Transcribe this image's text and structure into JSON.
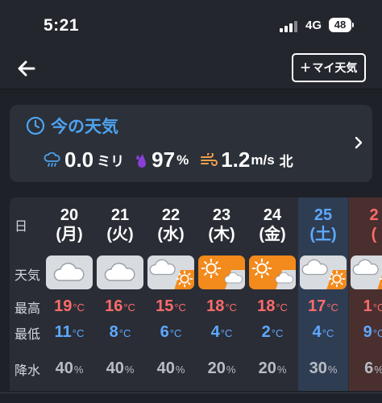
{
  "status": {
    "time": "5:21",
    "network": "4G",
    "battery": "48"
  },
  "nav": {
    "add_label": "マイ天気"
  },
  "now": {
    "title": "今の天気",
    "precip_value": "0.0",
    "precip_unit": "ミリ",
    "humidity_value": "97",
    "humidity_unit": "%",
    "wind_value": "1.2",
    "wind_unit": "m/s",
    "wind_dir": "北"
  },
  "forecast": {
    "labels": {
      "day": "日",
      "weather": "天気",
      "high": "最高",
      "low": "最低",
      "rain": "降水"
    },
    "temp_unit": "°C",
    "pct_unit": "%",
    "days": [
      {
        "date": "20",
        "dow": "(月)",
        "weather": "cloudy-icon",
        "high": "19",
        "low": "11",
        "rain": "40"
      },
      {
        "date": "21",
        "dow": "(火)",
        "weather": "cloudy-icon",
        "high": "16",
        "low": "8",
        "rain": "40"
      },
      {
        "date": "22",
        "dow": "(水)",
        "weather": "cloudy-then-sunny-icon",
        "high": "15",
        "low": "6",
        "rain": "40"
      },
      {
        "date": "23",
        "dow": "(木)",
        "weather": "sunny-then-cloudy-icon",
        "high": "18",
        "low": "4",
        "rain": "20"
      },
      {
        "date": "24",
        "dow": "(金)",
        "weather": "sunny-then-cloudy-icon",
        "high": "18",
        "low": "2",
        "rain": "20"
      },
      {
        "date": "25",
        "dow": "(土)",
        "weather": "cloudy-then-sunny-icon",
        "high": "17",
        "low": "4",
        "rain": "30"
      },
      {
        "date": "2",
        "dow": "(",
        "weather": "cloudy-then-sunny-icon",
        "high": "1",
        "low": "9",
        "rain": "6"
      }
    ]
  },
  "colors": {
    "accent_blue": "#4da3f0",
    "high": "#ff6b6b",
    "low": "#5ea8ff",
    "sun_orange": "#f28a1c",
    "saturday": "#5ea8ff",
    "sunday": "#ff6b6b"
  }
}
